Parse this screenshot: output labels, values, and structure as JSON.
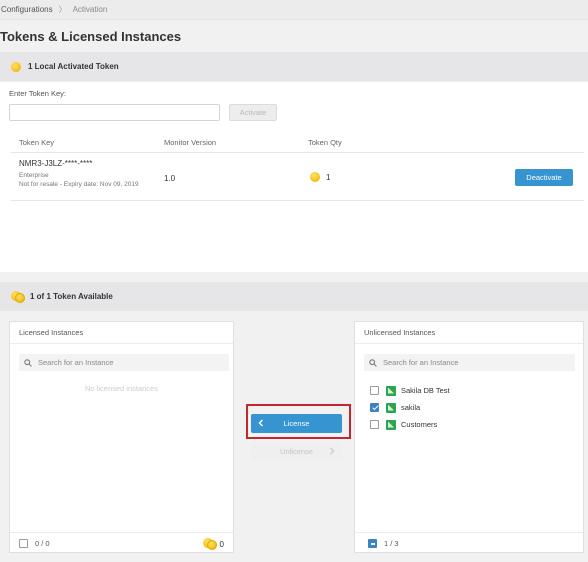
{
  "breadcrumb": {
    "parent": "Configurations",
    "separator": "〉",
    "current": "Activation"
  },
  "page_title": "Tokens & Licensed Instances",
  "local_tokens": {
    "header": "1 Local Activated Token",
    "enter_label": "Enter Token Key:",
    "input_value": "",
    "input_placeholder": "",
    "activate_label": "Activate",
    "columns": {
      "token_key": "Token Key",
      "monitor_version": "Monitor Version",
      "token_qty": "Token Qty"
    },
    "rows": [
      {
        "token_key": "NMR3-J3LZ-****-****",
        "edition": "Enterprise",
        "resale_note": "Not for resale - Expiry date: Nov 09, 2019",
        "monitor_version": "1.0",
        "qty": "1",
        "deactivate_label": "Deactivate"
      }
    ]
  },
  "available_tokens": {
    "header": "1 of 1 Token Available"
  },
  "licensed": {
    "title": "Licensed Instances",
    "search_placeholder": "Search for an Instance",
    "empty_text": "No licensed instances",
    "footer_count": "0 / 0",
    "coin_count": "0"
  },
  "actions": {
    "license_label": "License",
    "unlicense_label": "Unlicense"
  },
  "unlicensed": {
    "title": "Unlicensed Instances",
    "search_placeholder": "Search for an Instance",
    "items": [
      {
        "name": "Sakila DB Test",
        "checked": false
      },
      {
        "name": "sakila",
        "checked": true
      },
      {
        "name": "Customers",
        "checked": false
      }
    ],
    "footer_count": "1 / 3"
  },
  "colors": {
    "accent": "#3694d1",
    "highlight": "#c4262e",
    "coin": "#f7c21c",
    "instance_icon": "#2da44e"
  }
}
